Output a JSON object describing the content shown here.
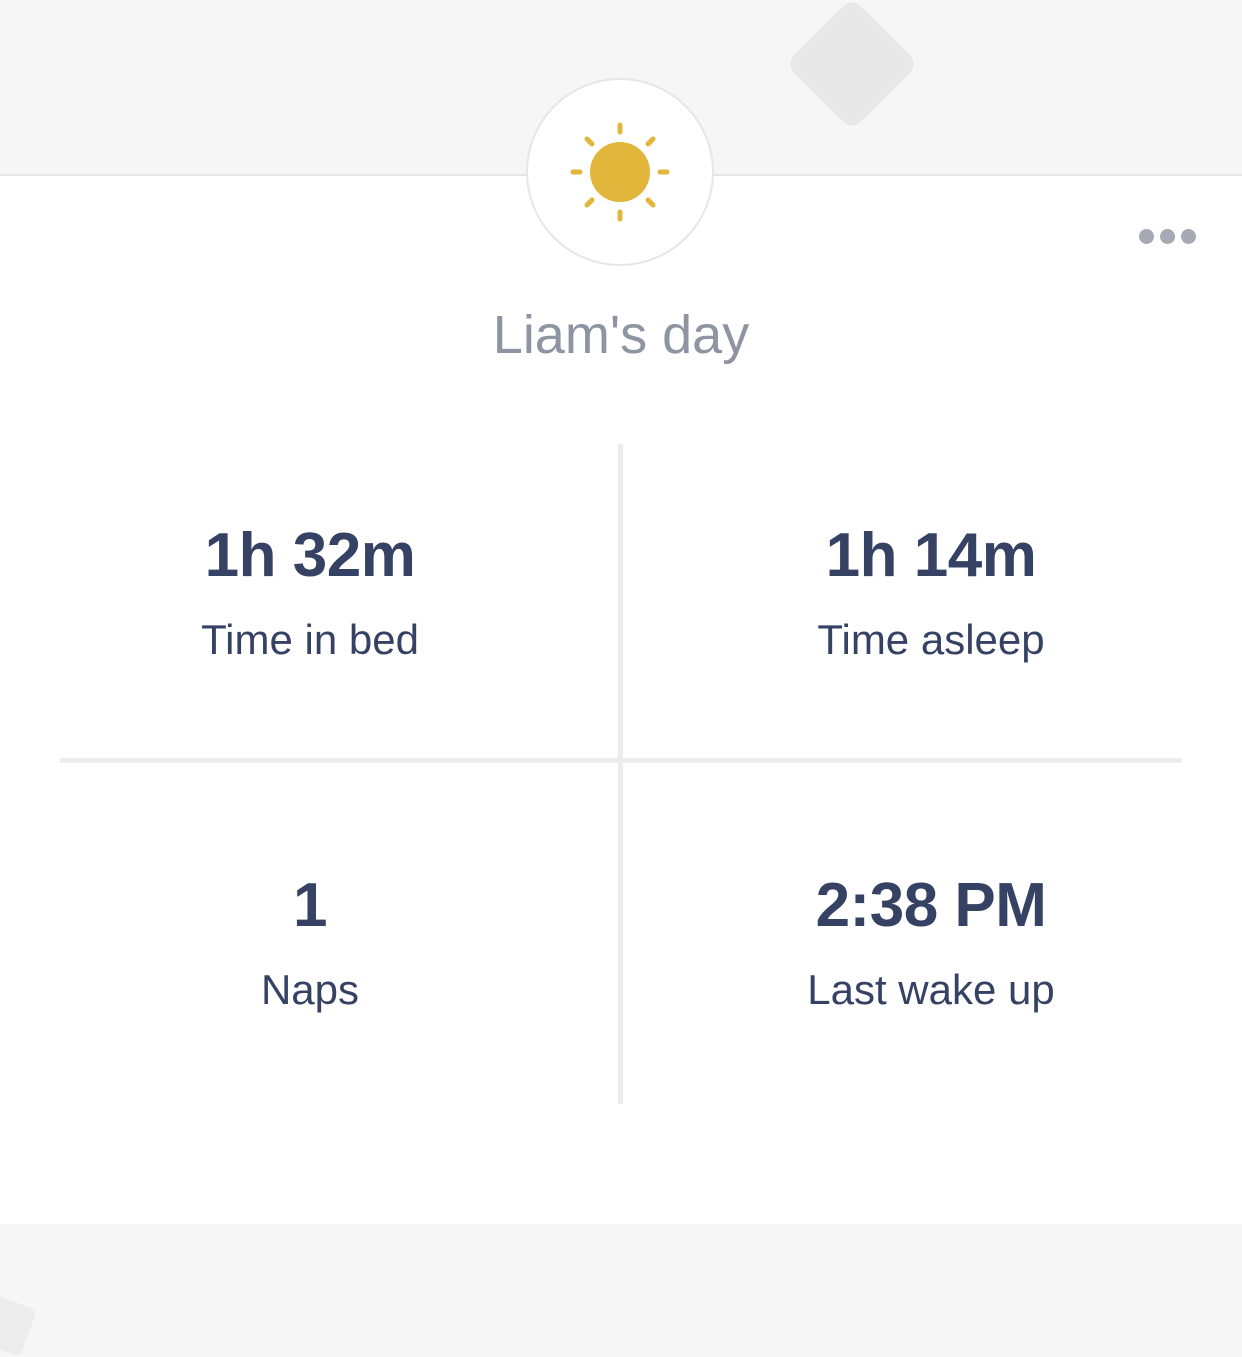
{
  "header": {
    "badge_icon": "sun-icon",
    "badge_color": "#e2b63b",
    "more_icon": "more-dots-icon"
  },
  "card": {
    "title": "Liam's day",
    "stats": [
      {
        "value": "1h 32m",
        "label": "Time in bed"
      },
      {
        "value": "1h 14m",
        "label": "Time asleep"
      },
      {
        "value": "1",
        "label": "Naps"
      },
      {
        "value": "2:38 PM",
        "label": "Last wake up"
      }
    ]
  },
  "colors": {
    "text_primary": "#364263",
    "text_muted": "#8f94a3",
    "background": "#f6f6f6",
    "card": "#ffffff",
    "divider": "#ececec"
  }
}
